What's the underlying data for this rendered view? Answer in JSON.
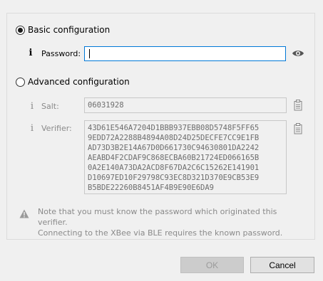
{
  "basic": {
    "radio_label": "Basic configuration",
    "selected": true,
    "password_label": "Password:",
    "password_value": ""
  },
  "advanced": {
    "radio_label": "Advanced configuration",
    "selected": false,
    "salt_label": "Salt:",
    "salt_value": "06031928",
    "verifier_label": "Verifier:",
    "verifier_value": "43D61E546A7204D1BBB937EBB08D5748F5FF65\n9EDD72A2288B4894A08D24D25DECFE7CC9E1FB\nAD73D3B2E14A67D0D661730C94630801DA2242\nAEABD4F2CDAF9C868ECBA60B21724ED066165B\n0A2E140A73DA2ACD8F67DA2C6C15262E141901\nD10697ED10F29798C93EC8D321D370E9CB53E9\nB5BDE22260B8451AF4B9E90E6DA9"
  },
  "note": {
    "line1": "Note that you must know the password which originated this verifier.",
    "line2": "Connecting to the XBee via BLE requires the known password."
  },
  "buttons": {
    "ok_label": "OK",
    "cancel_label": "Cancel"
  },
  "icons": {
    "info": "info-icon",
    "eye": "eye-icon",
    "clipboard": "clipboard-icon",
    "warning": "warning-icon"
  }
}
